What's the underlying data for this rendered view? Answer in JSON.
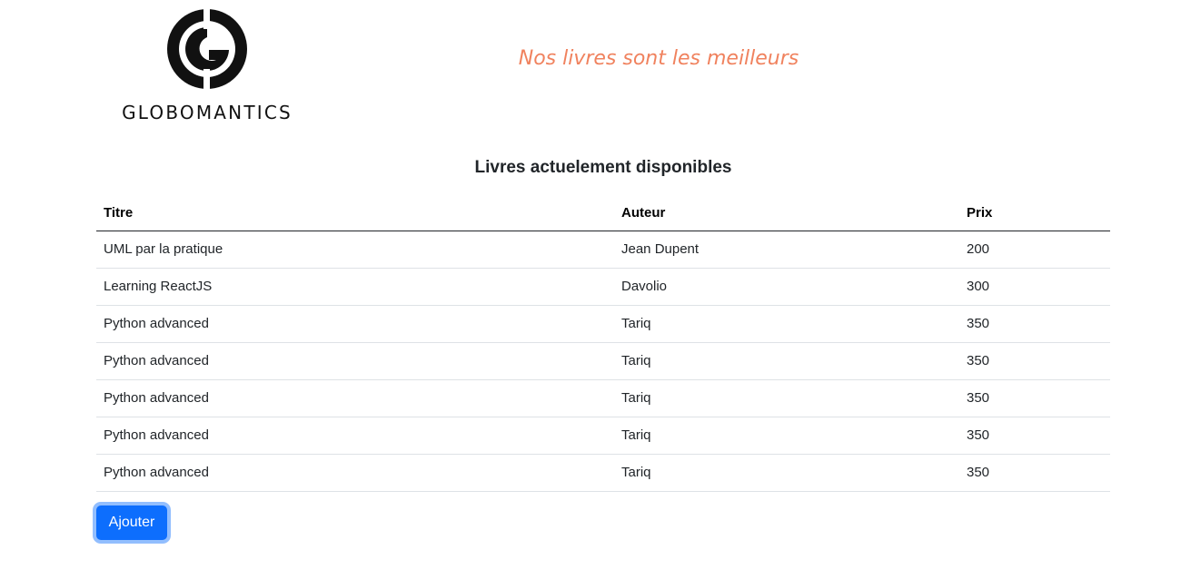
{
  "header": {
    "brand": "GLOBOMANTICS",
    "tagline": "Nos livres sont les meilleurs"
  },
  "main": {
    "title": "Livres actuelement disponibles",
    "table": {
      "columns": [
        "Titre",
        "Auteur",
        "Prix"
      ],
      "rows": [
        [
          "UML par la pratique",
          "Jean Dupent",
          "200"
        ],
        [
          "Learning ReactJS",
          "Davolio",
          "300"
        ],
        [
          "Python advanced",
          "Tariq",
          "350"
        ],
        [
          "Python advanced",
          "Tariq",
          "350"
        ],
        [
          "Python advanced",
          "Tariq",
          "350"
        ],
        [
          "Python advanced",
          "Tariq",
          "350"
        ],
        [
          "Python advanced",
          "Tariq",
          "350"
        ]
      ]
    },
    "add_button_label": "Ajouter"
  },
  "colors": {
    "tagline": "#f0825e",
    "button": "#0d6efd",
    "logo": "#111111"
  }
}
